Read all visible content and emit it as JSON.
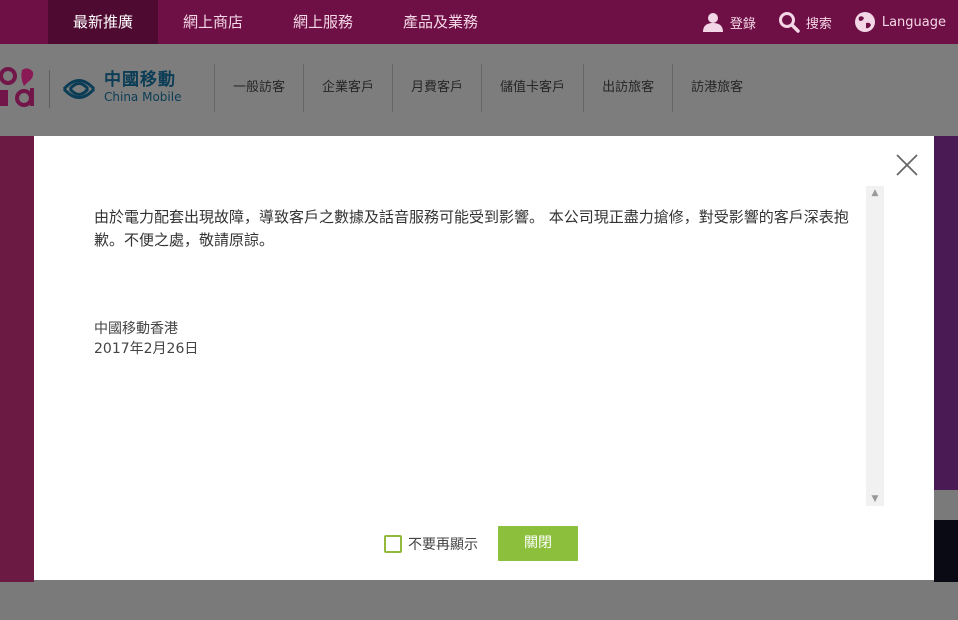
{
  "top_nav": {
    "items": [
      {
        "label": "最新推廣",
        "active": true
      },
      {
        "label": "網上商店",
        "active": false
      },
      {
        "label": "網上服務",
        "active": false
      },
      {
        "label": "產品及業務",
        "active": false
      }
    ],
    "utils": {
      "login": "登錄",
      "search": "搜索",
      "language": "Language"
    }
  },
  "brand": {
    "cn_name": "中國移動",
    "en_name": "China Mobile"
  },
  "main_nav": {
    "items": [
      "一般訪客",
      "企業客戶",
      "月費客戶",
      "儲值卡客戶",
      "出訪旅客",
      "訪港旅客"
    ]
  },
  "modal": {
    "message": "由於電力配套出現故障，導致客戶之數據及話音服務可能受到影響。 本公司現正盡力搶修，對受影響的客戶深表抱歉。不便之處，敬請原諒。",
    "signature": "中國移動香港",
    "date": "2017年2月26日",
    "dont_show_label": "不要再顯示",
    "close_label": "關閉"
  },
  "colors": {
    "top_bar": "#6e0f45",
    "accent_green": "#8cbf3c"
  }
}
